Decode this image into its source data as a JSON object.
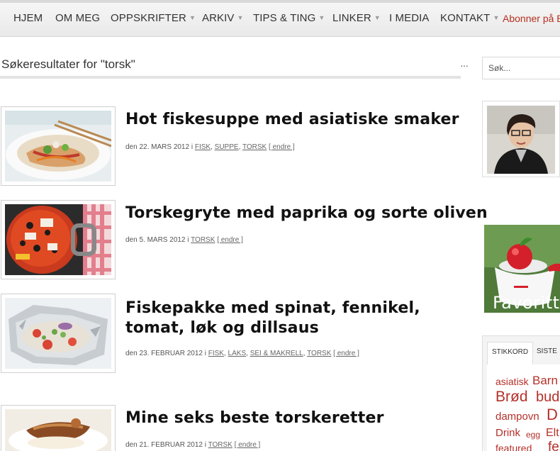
{
  "nav": {
    "items": [
      {
        "label": "HJEM",
        "dropdown": false
      },
      {
        "label": "OM MEG",
        "dropdown": false
      },
      {
        "label": "OPPSKRIFTER",
        "dropdown": true
      },
      {
        "label": "ARKIV",
        "dropdown": true
      },
      {
        "label": "TIPS & TING",
        "dropdown": true
      },
      {
        "label": "LINKER",
        "dropdown": true
      },
      {
        "label": "I MEDIA",
        "dropdown": false
      },
      {
        "label": "KONTAKT",
        "dropdown": true
      }
    ],
    "subscribe_label": "Abonner på B",
    "caret": "▼"
  },
  "search": {
    "heading": "Søkeresultater for \"torsk\"",
    "dots": "···",
    "placeholder": "Søk..."
  },
  "posts": [
    {
      "title": "Hot fiskesuppe med asiatiske smaker",
      "date": "den 22. MARS 2012",
      "in": "i",
      "categories": [
        "FISK",
        "SUPPE",
        "TORSK"
      ],
      "edit": "[ endre ]"
    },
    {
      "title": "Torskegryte med paprika og sorte oliven",
      "date": "den 5. MARS 2012",
      "in": "i",
      "categories": [
        "TORSK"
      ],
      "edit": "[ endre ]"
    },
    {
      "title": "Fiskepakke med spinat, fennikel, tomat, løk og dillsaus",
      "date": "den 23. FEBRUAR 2012",
      "in": "i",
      "categories": [
        "FISK",
        "LAKS",
        "SEI & MAKRELL",
        "TORSK"
      ],
      "edit": "[ endre ]"
    },
    {
      "title": "Mine seks beste torskeretter",
      "date": "den 21. FEBRUAR 2012",
      "in": "i",
      "categories": [
        "TORSK"
      ],
      "edit": "[ endre ]"
    }
  ],
  "sidebar": {
    "favorites_label": "Favoritte",
    "tabs": [
      "STIKKORD",
      "SISTE"
    ],
    "tags": [
      "asiatisk",
      "Barn",
      "Brød",
      "bud",
      "dampovn",
      "D",
      "Drink",
      "egg",
      "Elt",
      "featured",
      "fes"
    ]
  },
  "colors": {
    "accent": "#b5301f",
    "tag": "#b5302a",
    "nav_bg": "#ececec"
  }
}
